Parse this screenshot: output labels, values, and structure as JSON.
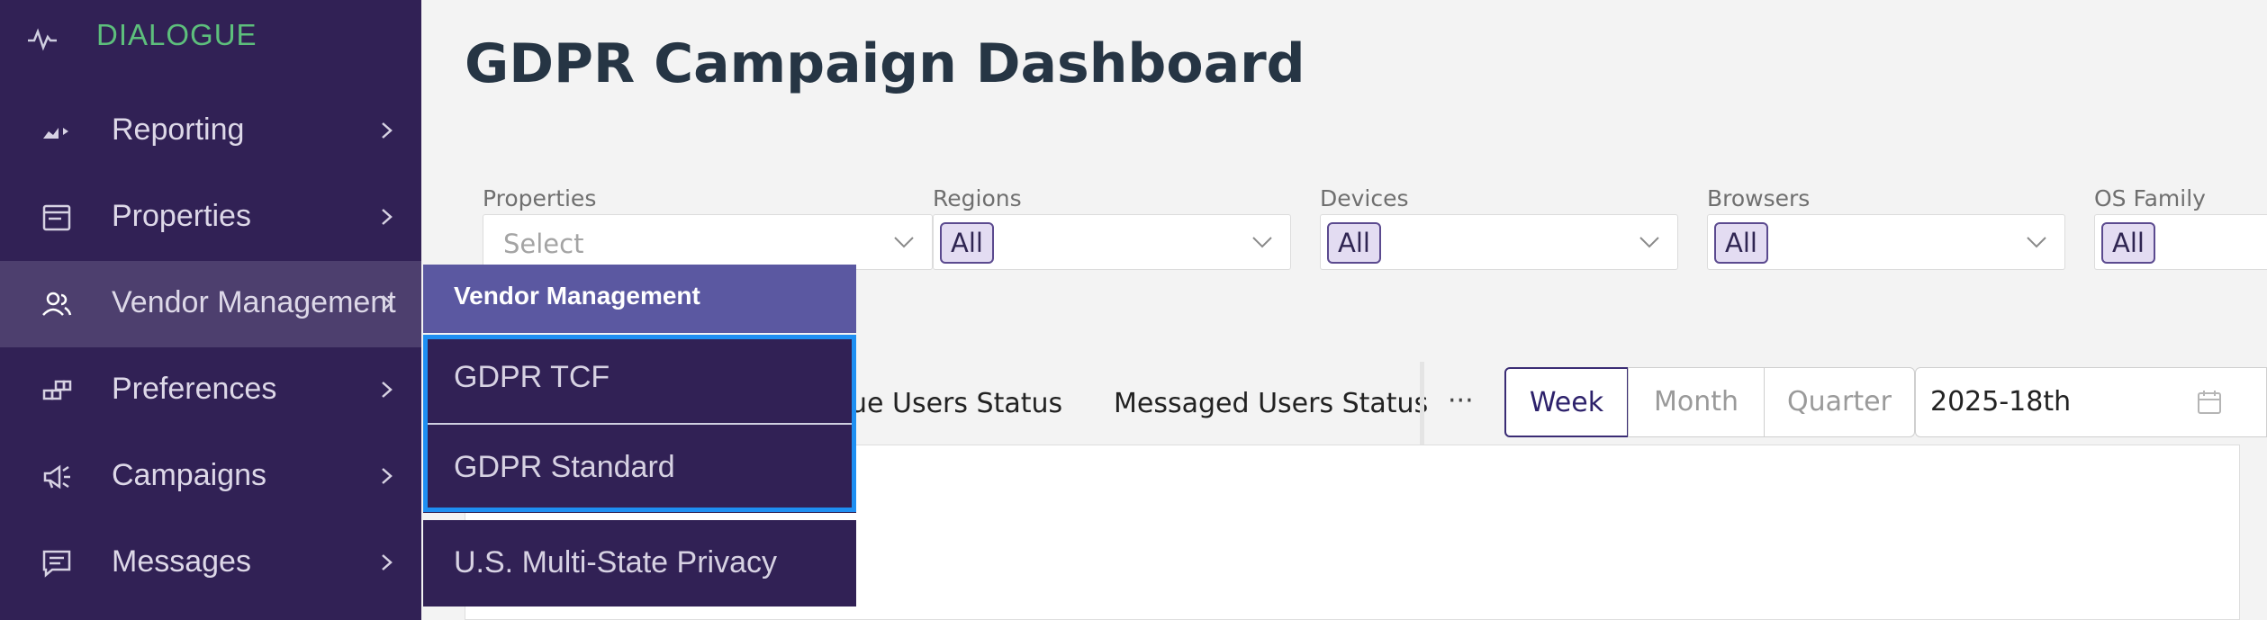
{
  "brand": {
    "name": "DIALOGUE",
    "icon": "pulse-icon"
  },
  "sidebar": {
    "items": [
      {
        "label": "Reporting",
        "icon": "chart-icon",
        "active": false
      },
      {
        "label": "Properties",
        "icon": "browser-window-icon",
        "active": false
      },
      {
        "label": "Vendor Management",
        "icon": "users-icon",
        "active": true
      },
      {
        "label": "Preferences",
        "icon": "blocks-icon",
        "active": false
      },
      {
        "label": "Campaigns",
        "icon": "megaphone-icon",
        "active": false
      },
      {
        "label": "Messages",
        "icon": "message-icon",
        "active": false
      }
    ]
  },
  "page": {
    "title": "GDPR Campaign Dashboard"
  },
  "filters": [
    {
      "label": "Properties",
      "placeholder": "Select",
      "value": ""
    },
    {
      "label": "Regions",
      "value": "All"
    },
    {
      "label": "Devices",
      "value": "All"
    },
    {
      "label": "Browsers",
      "value": "All"
    },
    {
      "label": "OS Family",
      "value": "All"
    }
  ],
  "tabs": {
    "items": [
      "ue Users Status",
      "Messaged Users Status"
    ],
    "more": "···"
  },
  "range": {
    "options": [
      "Week",
      "Month",
      "Quarter"
    ],
    "selected": "Week",
    "date": "2025-18th"
  },
  "flyout": {
    "title": "Vendor Management",
    "items": [
      "GDPR TCF",
      "GDPR Standard",
      "U.S. Multi-State Privacy"
    ]
  },
  "colors": {
    "sidebar": "#312155",
    "sidebar_active": "#4d3f6e",
    "brand": "#5dbf7c",
    "flyout_header": "#5b58a1",
    "focus": "#1e8ff2"
  }
}
